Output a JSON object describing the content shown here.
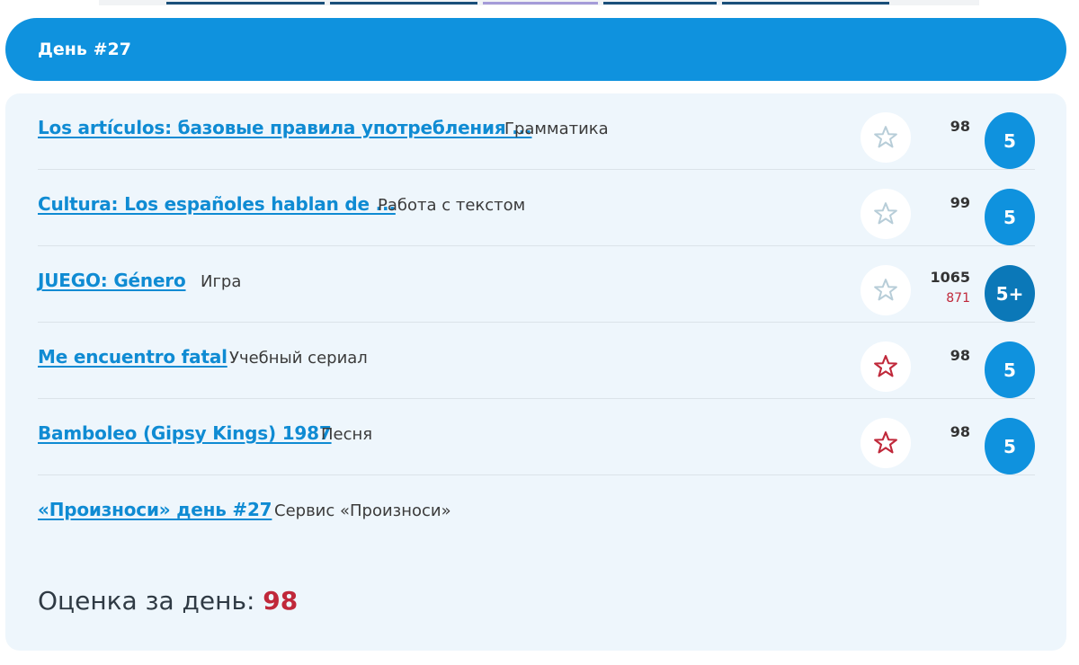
{
  "day_header": {
    "title": "День #27"
  },
  "rows": [
    {
      "title": "Los artículos: базовые правила употребления ...",
      "category": "Грамматика",
      "starred": false,
      "score": "98",
      "score_sub": "",
      "grade": "5"
    },
    {
      "title": "Cultura: Los españoles hablan de ...",
      "category": "Работа с текстом",
      "starred": false,
      "score": "99",
      "score_sub": "",
      "grade": "5"
    },
    {
      "title": "JUEGO: Género",
      "category": "Игра",
      "starred": false,
      "score": "1065",
      "score_sub": "871",
      "grade": "5+"
    },
    {
      "title": "Me encuentro fatal",
      "category": "Учебный сериал",
      "starred": true,
      "score": "98",
      "score_sub": "",
      "grade": "5"
    },
    {
      "title": "Bamboleo (Gipsy Kings) 1987",
      "category": "Песня",
      "starred": true,
      "score": "98",
      "score_sub": "",
      "grade": "5"
    },
    {
      "title": "«Произноси» день #27",
      "category": "Сервис «Произноси»"
    }
  ],
  "summary": {
    "label": "Оценка за день:",
    "value": "98"
  },
  "colors": {
    "accent": "#0f92de",
    "link": "#0f8bd3",
    "star_outline": "#b7cdd8",
    "star_active": "#c0283a",
    "panel_bg": "#eef6fc"
  },
  "icons": {
    "star_empty": "star-outline-icon",
    "star_filled": "star-red-outline-icon"
  }
}
